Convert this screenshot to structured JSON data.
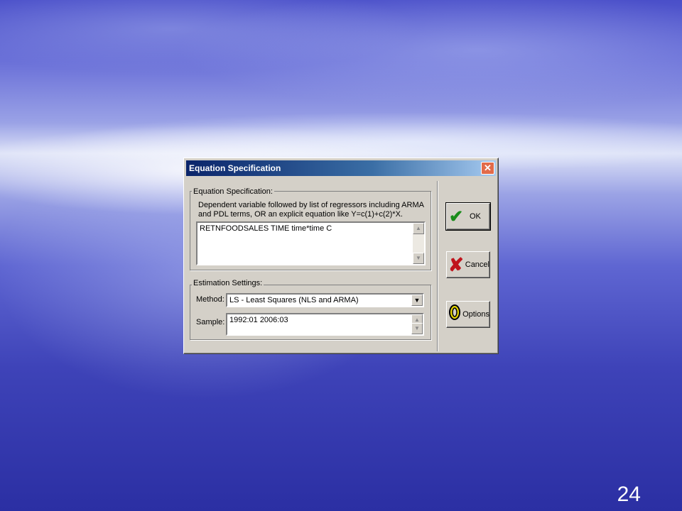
{
  "dialog": {
    "title": "Equation Specification",
    "close_glyph": "✕",
    "spec_group_label": "Equation Specification:",
    "description": "Dependent variable followed by list of regressors including ARMA and PDL terms, OR an explicit equation like Y=c(1)+c(2)*X.",
    "equation_value": "RETNFOODSALES TIME  time*time C",
    "settings_group_label": "Estimation Settings:",
    "method_label": "Method:",
    "method_value": "LS  -  Least Squares (NLS and ARMA)",
    "sample_label": "Sample:",
    "sample_value": "1992:01 2006:03",
    "buttons": {
      "ok_label": "OK",
      "cancel_label": "Cancel",
      "options_label": "Options"
    },
    "icons": {
      "ok": "check-icon",
      "cancel": "x-mark-icon",
      "options": "options-icon"
    },
    "accent_colors": {
      "ok_icon": "#1a8c1a",
      "cancel_icon": "#c0141c",
      "options_icon": "#e8d800"
    }
  },
  "slide": {
    "number": "24"
  }
}
